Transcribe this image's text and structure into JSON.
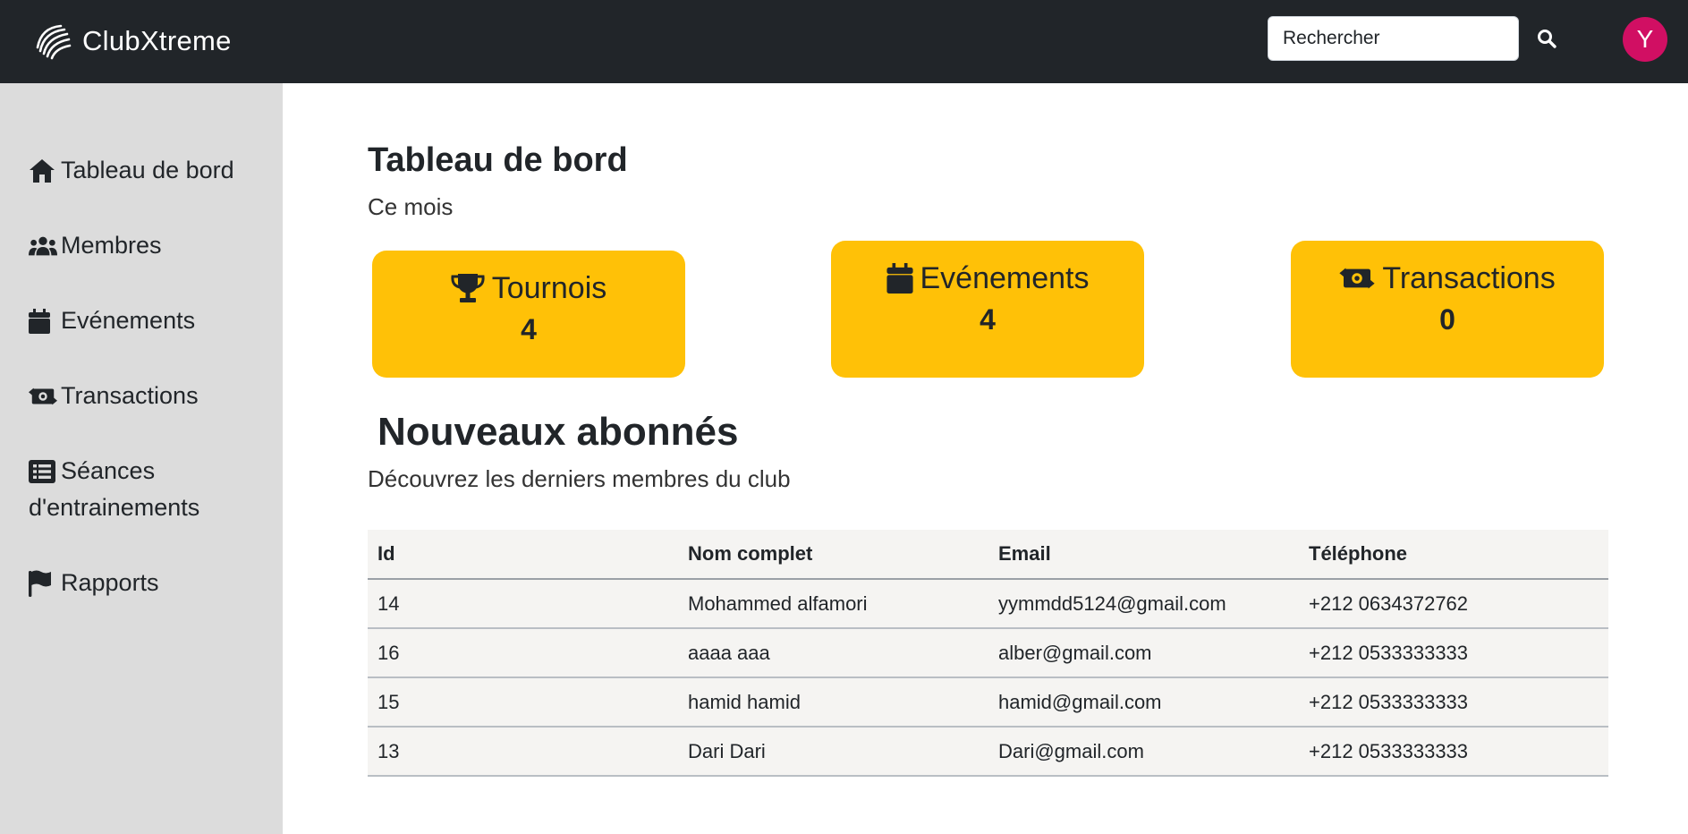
{
  "header": {
    "brand": "ClubXtreme",
    "search_placeholder": "Rechercher",
    "avatar_initial": "Y",
    "avatar_color": "#d10f63"
  },
  "sidebar": {
    "items": [
      {
        "label": "Tableau de bord",
        "icon": "home-icon"
      },
      {
        "label": "Membres",
        "icon": "users-icon"
      },
      {
        "label": "Evénements",
        "icon": "calendar-icon"
      },
      {
        "label": "Transactions",
        "icon": "money-exchange-icon"
      },
      {
        "label": "Séances d'entrainements",
        "icon": "list-icon"
      },
      {
        "label": "Rapports",
        "icon": "flag-icon"
      }
    ]
  },
  "main": {
    "title": "Tableau de bord",
    "subtitle": "Ce mois",
    "stats": [
      {
        "label": "Tournois",
        "value": "4",
        "icon": "trophy-icon"
      },
      {
        "label": "Evénements",
        "value": "4",
        "icon": "calendar-icon"
      },
      {
        "label": "Transactions",
        "value": "0",
        "icon": "money-exchange-icon"
      }
    ],
    "accent_color": "#ffc107",
    "section_title": "Nouveaux abonnés",
    "section_subtitle": "Découvrez les derniers membres du club",
    "table": {
      "headers": [
        "Id",
        "Nom complet",
        "Email",
        "Téléphone"
      ],
      "rows": [
        [
          "14",
          "Mohammed alfamori",
          "yymmdd5124@gmail.com",
          "+212 0634372762"
        ],
        [
          "16",
          "aaaa aaa",
          "alber@gmail.com",
          "+212 0533333333"
        ],
        [
          "15",
          "hamid hamid",
          "hamid@gmail.com",
          "+212 0533333333"
        ],
        [
          "13",
          "Dari Dari",
          "Dari@gmail.com",
          "+212 0533333333"
        ]
      ]
    }
  }
}
